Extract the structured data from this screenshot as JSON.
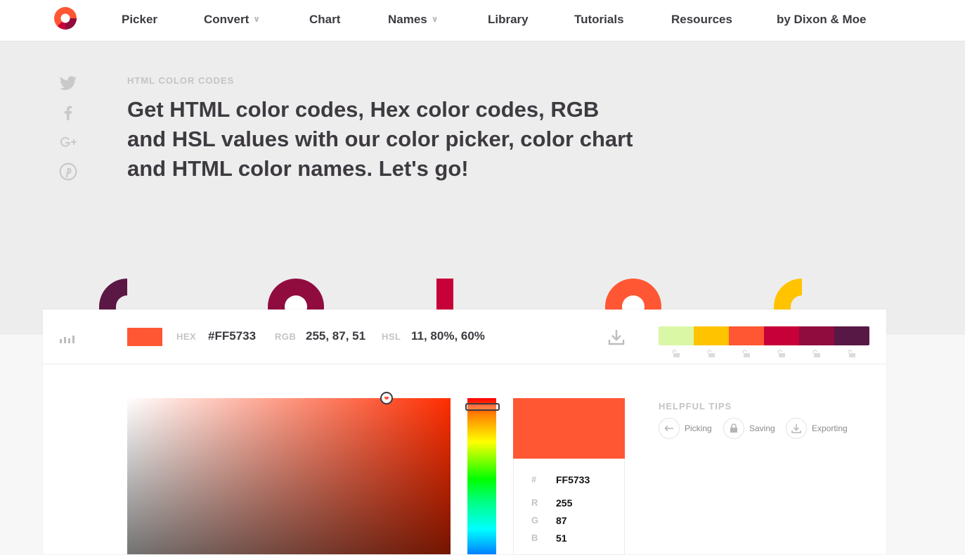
{
  "nav": {
    "items": [
      {
        "label": "Picker"
      },
      {
        "label": "Convert",
        "has_dropdown": true
      },
      {
        "label": "Chart"
      },
      {
        "label": "Names",
        "has_dropdown": true
      },
      {
        "label": "Library"
      },
      {
        "label": "Tutorials"
      },
      {
        "label": "Resources"
      },
      {
        "label": "by Dixon & Moe"
      }
    ],
    "dropdown_icon": "chevron-down-icon",
    "logo_icon": "logo-icon"
  },
  "social": [
    "twitter-icon",
    "facebook-icon",
    "google-plus-icon",
    "pinterest-icon"
  ],
  "hero": {
    "eyebrow": "HTML COLOR CODES",
    "headline": "Get HTML color codes, Hex color codes, RGB and HSL values with our color picker, color chart and HTML color names. Let's go!",
    "decor_colors": [
      "#5B1845",
      "#900C3F",
      "#C70039",
      "#FF5733",
      "#FFC300"
    ]
  },
  "color_bar": {
    "swatch": "#FF5733",
    "hex_label": "HEX",
    "hex_value": "#FF5733",
    "rgb_label": "RGB",
    "rgb_value": "255, 87, 51",
    "hsl_label": "HSL",
    "hsl_value": "11, 80%, 60%",
    "download_icon": "download-icon",
    "stats_icon": "bar-chart-icon"
  },
  "palette": [
    "#DAF7A6",
    "#FFC300",
    "#FF5733",
    "#C70039",
    "#900C3F",
    "#581845"
  ],
  "picker": {
    "saturation": 0.8,
    "hue_degrees": 11
  },
  "details": {
    "hash_label": "#",
    "hex": "FF5733",
    "r_label": "R",
    "r": "255",
    "g_label": "G",
    "g": "87",
    "b_label": "B",
    "b": "51"
  },
  "tips": {
    "title": "HELPFUL TIPS",
    "items": [
      {
        "label": "Picking",
        "icon": "arrow-left-icon"
      },
      {
        "label": "Saving",
        "icon": "lock-icon"
      },
      {
        "label": "Exporting",
        "icon": "download-icon"
      }
    ]
  }
}
